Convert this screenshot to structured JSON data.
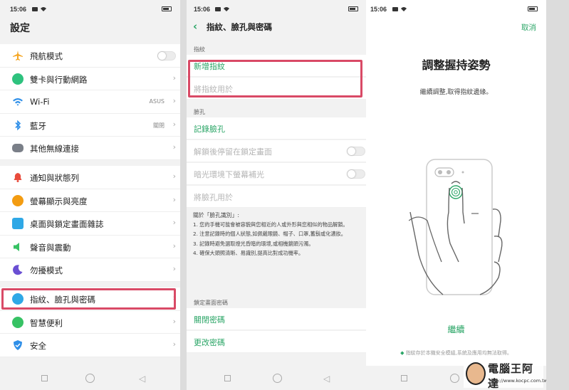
{
  "status": {
    "time": "15:06"
  },
  "screen1": {
    "title": "設定",
    "group1": [
      {
        "label": "飛航模式",
        "icon": "airplane-icon",
        "color": "#f5a623",
        "kind": "toggle"
      },
      {
        "label": "雙卡與行動網路",
        "icon": "globe-icon",
        "color": "#2ec27e",
        "kind": "chevron"
      },
      {
        "label": "Wi-Fi",
        "value": "ASUS",
        "icon": "wifi-icon",
        "color": "#2f8fe8",
        "kind": "chevron"
      },
      {
        "label": "藍牙",
        "value": "關閉",
        "icon": "bluetooth-icon",
        "color": "#2f8fe8",
        "kind": "chevron"
      },
      {
        "label": "其他無線連接",
        "icon": "more-icon",
        "color": "#7a7f88",
        "kind": "chevron"
      }
    ],
    "group2": [
      {
        "label": "通知與狀態列",
        "icon": "bell-icon",
        "color": "#e94b3c"
      },
      {
        "label": "螢幕顯示與亮度",
        "icon": "brightness-icon",
        "color": "#f39c12"
      },
      {
        "label": "桌面與鎖定畫面雜誌",
        "icon": "image-icon",
        "color": "#2fa8e6"
      },
      {
        "label": "聲音與震動",
        "icon": "speaker-icon",
        "color": "#37c264"
      },
      {
        "label": "勿擾模式",
        "icon": "moon-icon",
        "color": "#6a4fd3"
      }
    ],
    "group3": [
      {
        "label": "指紋、臉孔與密碼",
        "icon": "fingerprint-icon",
        "color": "#2fa8e6"
      },
      {
        "label": "智慧便利",
        "icon": "lightbulb-icon",
        "color": "#37c264"
      },
      {
        "label": "安全",
        "icon": "shield-icon",
        "color": "#2f8fe8"
      }
    ]
  },
  "screen2": {
    "title": "指紋、臉孔與密碼",
    "fp_header": "指紋",
    "fp_add": "新增指紋",
    "fp_use": "將指紋用於",
    "face_header": "臉孔",
    "face_record": "記錄臉孔",
    "face_stay_lock": "解鎖後停留在鎖定畫面",
    "face_fill_light": "暗光環境下螢幕補光",
    "face_use": "將臉孔用於",
    "about_title": "關於「臉孔識別」:",
    "about_1": "1. 您的手機可能會被容貌與您相近的人或外形與您相似的物品解鎖。",
    "about_2": "2. 注意記錄時的個人狀態,如佩戴眼鏡、帽子、口罩,蓄鬍或化濃妝。",
    "about_3": "3. 記錄時避免選取燈光昏暗的環境,或相機鏡頭污濁。",
    "about_4": "4. 確保大頭照清晰、易識別,提高比對成功機率。",
    "lock_header": "鎖定畫面密碼",
    "pw_off": "關閉密碼",
    "pw_change": "更改密碼"
  },
  "screen3": {
    "cancel": "取消",
    "title": "調整握持姿勢",
    "subtitle": "繼續調整,取得指紋邊緣。",
    "continue": "繼續",
    "footer": "指紋存於本機安全模組,系統及應用均無法取得。"
  },
  "watermark": {
    "title": "電腦王阿達",
    "url": "http://www.kocpc.com.tw"
  },
  "colors": {
    "accent": "#2aa566",
    "highlight": "#d94a66"
  }
}
